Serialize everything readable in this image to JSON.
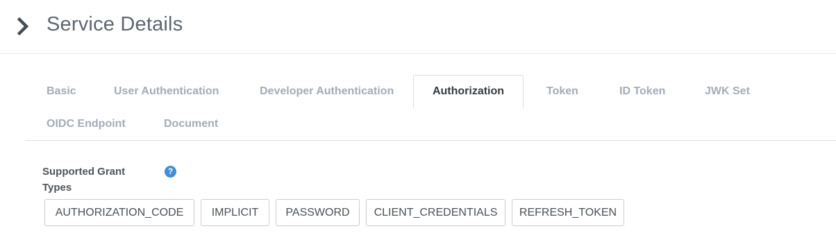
{
  "header": {
    "title": "Service Details",
    "toggle_icon": "chevron-right-icon"
  },
  "tabs": [
    {
      "label": "Basic"
    },
    {
      "label": "User Authentication"
    },
    {
      "label": "Developer Authentication"
    },
    {
      "label": "Authorization",
      "active": true
    },
    {
      "label": "Token"
    },
    {
      "label": "ID Token"
    },
    {
      "label": "JWK Set"
    },
    {
      "label": "OIDC Endpoint"
    },
    {
      "label": "Document"
    }
  ],
  "grant_types": {
    "label": "Supported Grant Types",
    "help_icon": "question-circle-icon",
    "help_glyph": "?",
    "options": [
      {
        "label": "AUTHORIZATION_CODE"
      },
      {
        "label": "IMPLICIT"
      },
      {
        "label": "PASSWORD"
      },
      {
        "label": "CLIENT_CREDENTIALS"
      },
      {
        "label": "REFRESH_TOKEN"
      }
    ]
  },
  "colors": {
    "help_icon": "#3f8fd3",
    "tab_inactive": "#a3acb7",
    "tab_active": "#333a40"
  }
}
